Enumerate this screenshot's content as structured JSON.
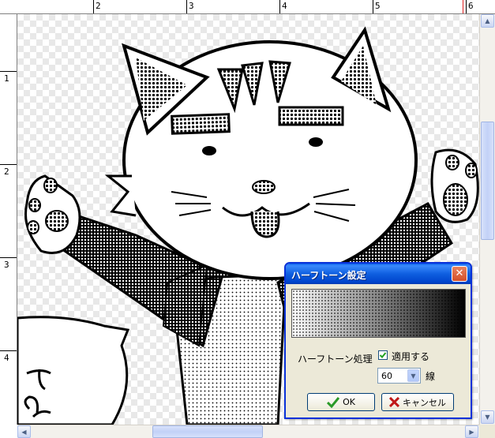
{
  "rulers": {
    "top_labels": [
      "2",
      "3",
      "4",
      "5",
      "6"
    ],
    "left_labels": [
      "1",
      "2",
      "3",
      "4"
    ]
  },
  "dialog": {
    "title": "ハーフトーン設定",
    "close_symbol": "✕",
    "halftone_label": "ハーフトーン処理",
    "apply_checked": true,
    "apply_label": "適用する",
    "lpi_value": "60",
    "lpi_unit": "線",
    "ok_label": "OK",
    "cancel_label": "キャンセル"
  },
  "colors": {
    "titlebar": "#0a5fe8",
    "dialog_bg": "#ece9d8",
    "ok_check": "#2a9a28",
    "cancel_x": "#c01818",
    "ruler_marker": "#e02020"
  },
  "icons": {
    "ok": "check-icon",
    "cancel": "x-icon",
    "close": "close-icon",
    "dropdown": "chevron-down-icon"
  }
}
